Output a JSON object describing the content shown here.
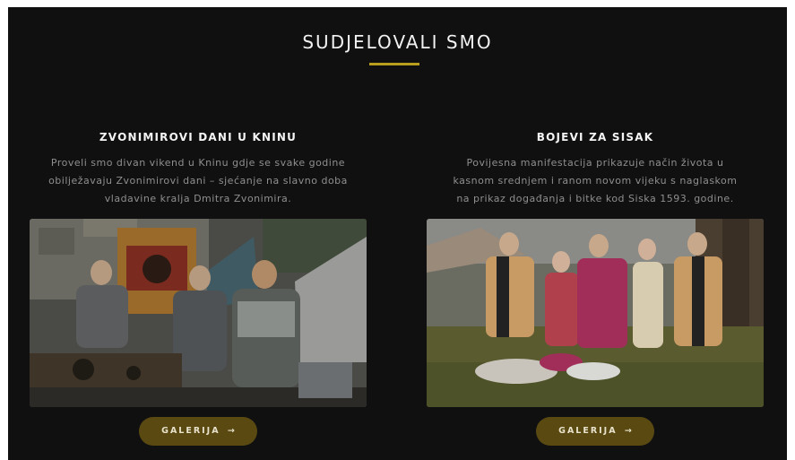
{
  "section": {
    "title": "SUDJELOVALI SMO"
  },
  "cards": [
    {
      "title": "ZVONIMIROVI DANI U KNINU",
      "description_lines": [
        "Proveli smo divan vikend u Kninu gdje se svake godine",
        "obilježavaju Zvonimirovi dani – sjećanje na slavno doba",
        "vladavine kralja Dmitra Zvonimira."
      ],
      "photo_icon": "photo-knights-castle",
      "button_label": "GALERIJA",
      "button_arrow": "→"
    },
    {
      "title": "BOJEVI ZA SISAK",
      "description_lines": [
        "Povijesna manifestacija prikazuje način života u",
        "kasnom srednjem i ranom novom vijeku s naglaskom",
        "na prikaz događanja i bitke kod Siska 1593. godine."
      ],
      "photo_icon": "photo-costumed-group",
      "button_label": "GALERIJA",
      "button_arrow": "→"
    }
  ],
  "colors": {
    "background": "#101010",
    "accent_rule": "#b89d1e",
    "button_bg": "#5a4a12",
    "title_text": "#f2f2f2",
    "body_text": "#8f8f8f"
  }
}
